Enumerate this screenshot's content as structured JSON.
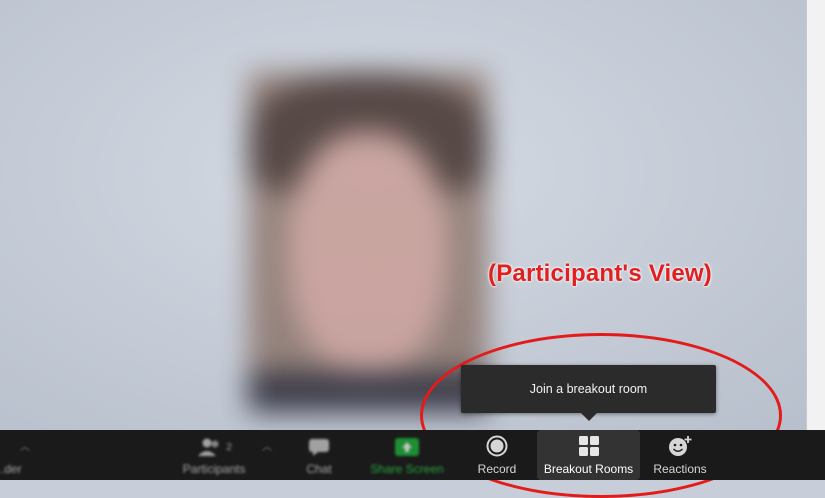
{
  "annotation": {
    "title": "(Participant's View)",
    "color": "#e02020"
  },
  "tooltip": {
    "text": "Join a breakout room"
  },
  "toolbar": {
    "items": [
      {
        "label": "...der",
        "icon": "stop-video-icon"
      },
      {
        "label": "Participants",
        "icon": "participants-icon",
        "badge": "2"
      },
      {
        "label": "Chat",
        "icon": "chat-icon"
      },
      {
        "label": "Share Screen",
        "icon": "share-screen-icon"
      },
      {
        "label": "Record",
        "icon": "record-icon"
      },
      {
        "label": "Breakout Rooms",
        "icon": "breakout-rooms-icon"
      },
      {
        "label": "Reactions",
        "icon": "reactions-icon"
      }
    ],
    "colors": {
      "background": "#1a1a1a",
      "share_green": "#1fb53c",
      "active_bg": "#333333"
    }
  }
}
